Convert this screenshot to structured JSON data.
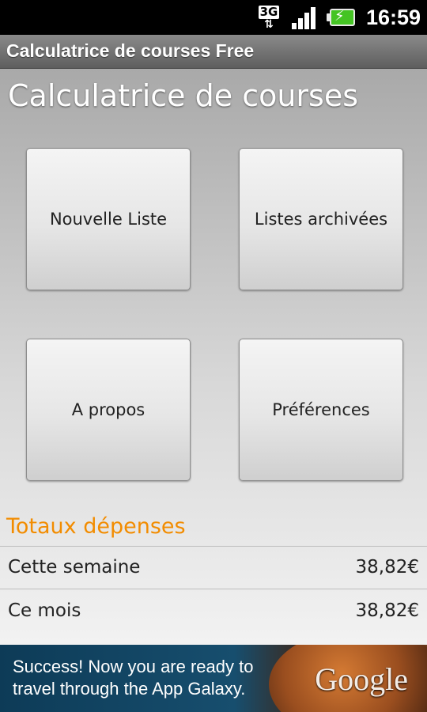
{
  "status_bar": {
    "network_type": "3G",
    "network_arrows": "⇅",
    "time": "16:59"
  },
  "app_bar": {
    "title": "Calculatrice de courses Free"
  },
  "main": {
    "title": "Calculatrice de courses",
    "buttons": {
      "new_list": "Nouvelle Liste",
      "archived_lists": "Listes archivées",
      "about": "A propos",
      "preferences": "Préférences"
    }
  },
  "totals": {
    "heading": "Totaux dépenses",
    "rows": [
      {
        "label": "Cette semaine",
        "value": "38,82€"
      },
      {
        "label": "Ce mois",
        "value": "38,82€"
      }
    ]
  },
  "ad": {
    "text": "Success! Now you are ready to travel through the App Galaxy.",
    "brand": "Google"
  },
  "colors": {
    "accent": "#f28c00",
    "battery": "#44c423",
    "title_bar": "#6e6e6e"
  },
  "icons": [
    "network-3g-icon",
    "signal-strength-icon",
    "battery-charging-icon"
  ]
}
